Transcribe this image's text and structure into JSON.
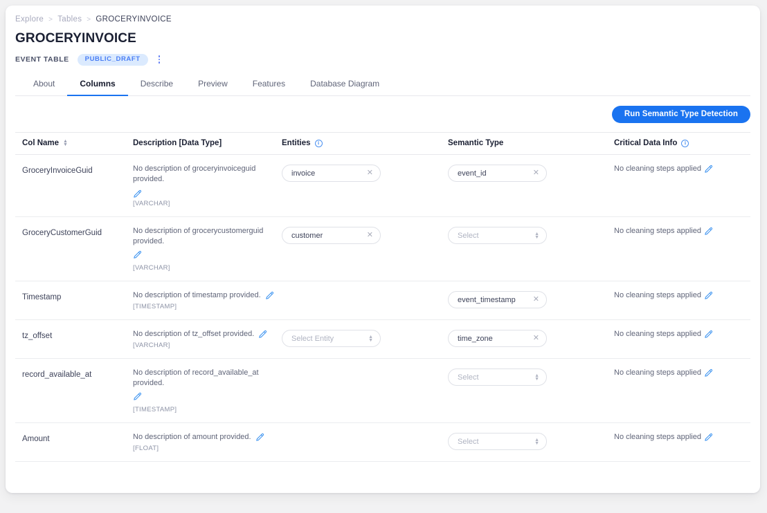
{
  "breadcrumb": {
    "items": [
      {
        "label": "Explore",
        "current": false
      },
      {
        "label": "Tables",
        "current": false
      },
      {
        "label": "GROCERYINVOICE",
        "current": true
      }
    ],
    "separator": ">"
  },
  "header": {
    "title": "GROCERYINVOICE",
    "kind": "EVENT TABLE",
    "badge": "PUBLIC_DRAFT",
    "menu_icon": "kebab-menu-icon"
  },
  "tabs": [
    {
      "label": "About",
      "active": false
    },
    {
      "label": "Columns",
      "active": true
    },
    {
      "label": "Describe",
      "active": false
    },
    {
      "label": "Preview",
      "active": false
    },
    {
      "label": "Features",
      "active": false
    },
    {
      "label": "Database Diagram",
      "active": false
    }
  ],
  "toolbar": {
    "run_detection_label": "Run Semantic Type Detection",
    "accent_color": "#1a73f0"
  },
  "table": {
    "columns": [
      {
        "key": "col_name",
        "label": "Col Name",
        "sortable": true,
        "info": false
      },
      {
        "key": "description",
        "label": "Description [Data Type]",
        "sortable": false,
        "info": false
      },
      {
        "key": "entities",
        "label": "Entities",
        "sortable": false,
        "info": true
      },
      {
        "key": "semantic_type",
        "label": "Semantic Type",
        "sortable": false,
        "info": false
      },
      {
        "key": "critical_data",
        "label": "Critical Data Info",
        "sortable": false,
        "info": true
      }
    ],
    "select_placeholder": "Select",
    "entity_placeholder": "Select Entity",
    "rows": [
      {
        "col_name": "GroceryInvoiceGuid",
        "description": "No description of groceryinvoiceguid provided.",
        "data_type": "[VARCHAR]",
        "desc_wrap": false,
        "entity": "invoice",
        "entity_empty": false,
        "entity_hidden": false,
        "semantic_type": "event_id",
        "semantic_empty": false,
        "critical_data": "No cleaning steps applied"
      },
      {
        "col_name": "GroceryCustomerGuid",
        "description": "No description of grocerycustomerguid provided.",
        "data_type": "[VARCHAR]",
        "desc_wrap": true,
        "entity": "customer",
        "entity_empty": false,
        "entity_hidden": false,
        "semantic_type": "",
        "semantic_empty": true,
        "critical_data": "No cleaning steps applied"
      },
      {
        "col_name": "Timestamp",
        "description": "No description of timestamp provided.",
        "data_type": "[TIMESTAMP]",
        "desc_wrap": false,
        "entity": "",
        "entity_empty": true,
        "entity_hidden": true,
        "semantic_type": "event_timestamp",
        "semantic_empty": false,
        "critical_data": "No cleaning steps applied"
      },
      {
        "col_name": "tz_offset",
        "description": "No description of tz_offset provided.",
        "data_type": "[VARCHAR]",
        "desc_wrap": false,
        "entity": "",
        "entity_empty": true,
        "entity_hidden": false,
        "semantic_type": "time_zone",
        "semantic_empty": false,
        "critical_data": "No cleaning steps applied"
      },
      {
        "col_name": "record_available_at",
        "description": "No description of record_available_at provided.",
        "data_type": "[TIMESTAMP]",
        "desc_wrap": true,
        "entity": "",
        "entity_empty": true,
        "entity_hidden": true,
        "semantic_type": "",
        "semantic_empty": true,
        "critical_data": "No cleaning steps applied"
      },
      {
        "col_name": "Amount",
        "description": "No description of amount provided.",
        "data_type": "[FLOAT]",
        "desc_wrap": false,
        "entity": "",
        "entity_empty": true,
        "entity_hidden": true,
        "semantic_type": "",
        "semantic_empty": true,
        "critical_data": "No cleaning steps applied"
      }
    ]
  }
}
